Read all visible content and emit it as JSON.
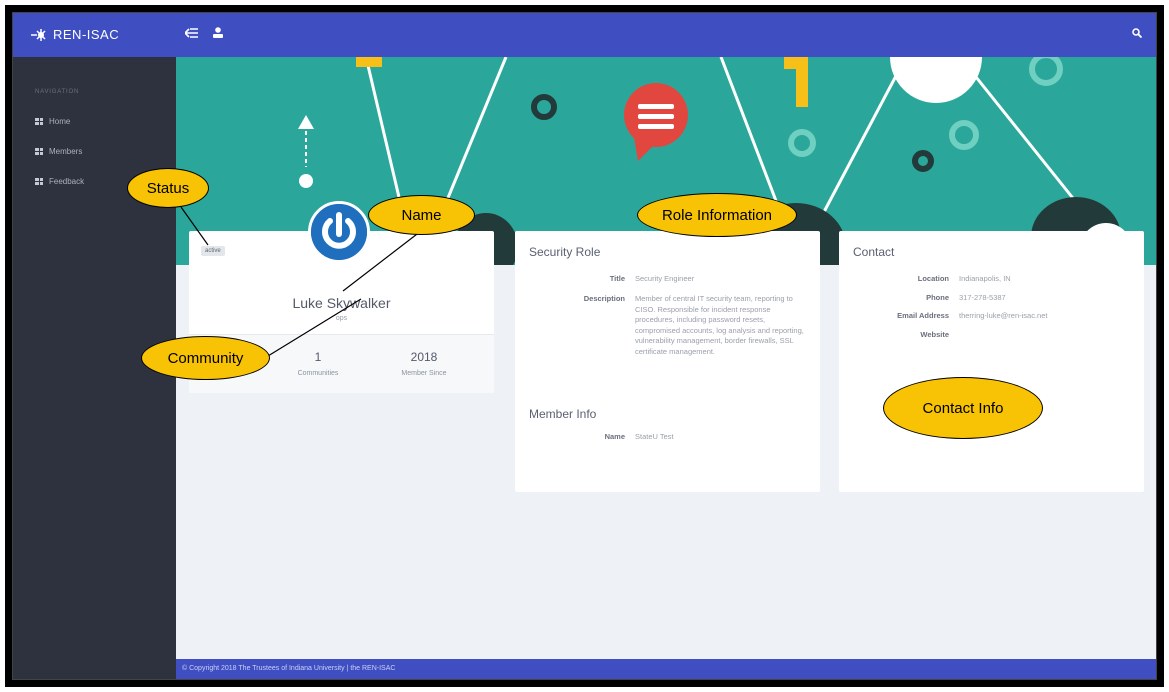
{
  "app": {
    "title": "REN-ISAC"
  },
  "topbar": {
    "collapse_icon": "menu-collapse-icon",
    "user_icon": "user-icon",
    "search_icon": "search-icon"
  },
  "sidebar": {
    "section_label": "NAVIGATION",
    "items": [
      {
        "label": "Home",
        "icon": "grid-icon"
      },
      {
        "label": "Members",
        "icon": "grid-icon"
      },
      {
        "label": "Feedback",
        "icon": "grid-icon"
      }
    ]
  },
  "profile": {
    "status": "active",
    "name": "Luke Skywalker",
    "community": "ops",
    "stats": [
      {
        "value": "1",
        "label": "Communities"
      },
      {
        "value": "2018",
        "label": "Member Since"
      }
    ]
  },
  "role": {
    "title": "Security Role",
    "fields": [
      {
        "key": "Title",
        "value": "Security Engineer"
      },
      {
        "key": "Description",
        "value": "Member of central IT security team, reporting to CISO. Responsible for incident response procedures, including password resets, compromised accounts, log analysis and reporting, vulnerability management, border firewalls, SSL certificate management."
      }
    ]
  },
  "member_info": {
    "title": "Member Info",
    "fields": [
      {
        "key": "Name",
        "value": "StateU Test"
      }
    ]
  },
  "contact": {
    "title": "Contact",
    "fields": [
      {
        "key": "Location",
        "value": "Indianapolis, IN"
      },
      {
        "key": "Phone",
        "value": "317-278-5387"
      },
      {
        "key": "Email Address",
        "value": "therring-luke@ren-isac.net"
      },
      {
        "key": "Website",
        "value": ""
      }
    ]
  },
  "callouts": {
    "status": "Status",
    "name": "Name",
    "community": "Community",
    "role": "Role Information",
    "contact": "Contact Info"
  },
  "footer": {
    "text": "© Copyright 2018 The Trustees of Indiana University | the REN-ISAC"
  },
  "colors": {
    "topbar": "#3f4fc2",
    "sidebar": "#2e323e",
    "hero": "#2aa79a",
    "callout": "#f8c305",
    "avatar": "#1f6fbe"
  }
}
